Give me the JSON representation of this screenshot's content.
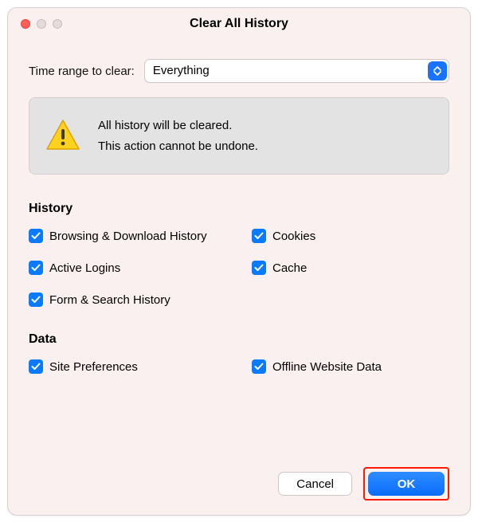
{
  "dialog": {
    "title": "Clear All History",
    "range_label": "Time range to clear:",
    "range_value": "Everything",
    "warning_line1": "All history will be cleared.",
    "warning_line2": "This action cannot be undone.",
    "section_history": "History",
    "section_data": "Data",
    "checks": {
      "browsing": "Browsing & Download History",
      "cookies": "Cookies",
      "active_logins": "Active Logins",
      "cache": "Cache",
      "form_search": "Form & Search History",
      "site_prefs": "Site Preferences",
      "offline_data": "Offline Website Data"
    },
    "buttons": {
      "cancel": "Cancel",
      "ok": "OK"
    }
  }
}
